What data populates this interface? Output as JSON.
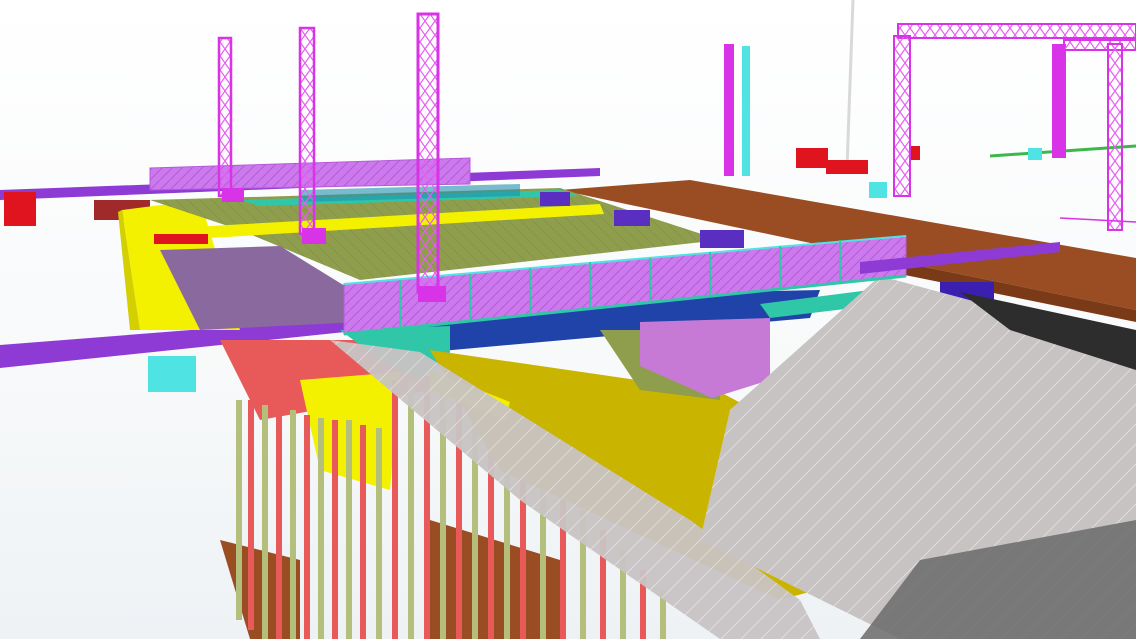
{
  "viewport": {
    "label": "",
    "background": "#f7f9fa"
  },
  "palette": {
    "magenta": "#d833e6",
    "purple": "#8e3bd6",
    "yellow": "#f4f100",
    "olive": "#c9b400",
    "red": "#e85a5a",
    "crimson": "#e0141e",
    "cyan": "#4fe3e3",
    "teal": "#2fc7a8",
    "navy": "#1f43a8",
    "green": "#8f9e4c",
    "brown": "#9a4d22",
    "concrete": "#c9c5c5",
    "violet": "#c67ad6",
    "steel": "#b3bf7a"
  },
  "model": {
    "type": "3d-bim-structural-model",
    "elements": [
      "tower-truss",
      "gantry-truss",
      "bridge-deck",
      "walkway-railing",
      "girder",
      "sheet-piles",
      "earth-slope",
      "formwork",
      "timber-deck"
    ]
  }
}
